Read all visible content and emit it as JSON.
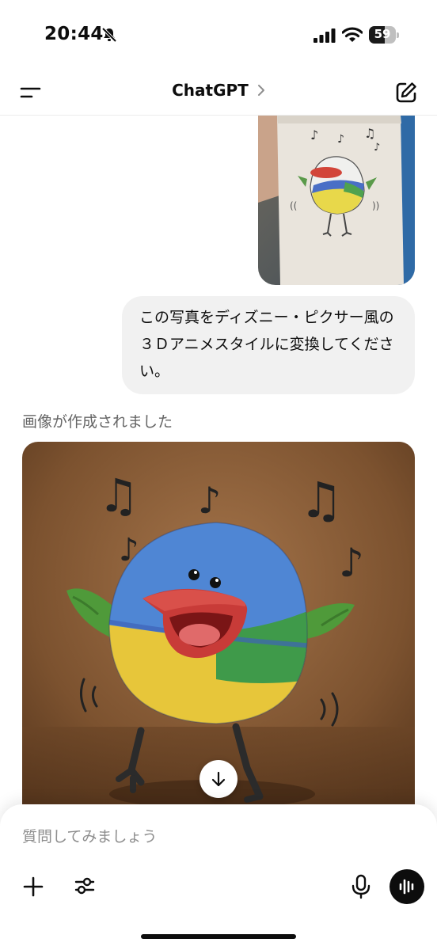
{
  "status_bar": {
    "time": "20:44",
    "battery_level": "59",
    "battery_fraction": 0.59
  },
  "header": {
    "title": "ChatGPT",
    "menu_icon": "menu-icon",
    "new_chat_icon": "compose-icon"
  },
  "conversation": {
    "user_message": "この写真をディズニー・ピクサー風の３Ｄアニメスタイルに変換してください。",
    "assistant_status": "画像が作成されました"
  },
  "composer": {
    "placeholder": "質問してみましょう"
  },
  "colors": {
    "bubble_bg": "#f1f1f1",
    "text": "#0d0d0d",
    "muted": "#666666",
    "voice_button": "#0d0d0d"
  }
}
